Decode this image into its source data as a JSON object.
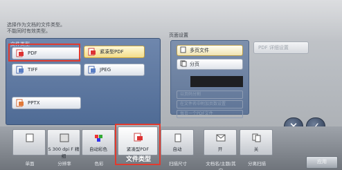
{
  "message": {
    "line1": "选择作为文档的文件类型。",
    "line2": "不能同时有效类型。"
  },
  "file_type_panel": {
    "label": "文件类型",
    "buttons": [
      {
        "label": "PDF",
        "selected": false
      },
      {
        "label": "紧凑型PDF",
        "selected": true
      },
      {
        "label": "TIFF",
        "selected": false
      },
      {
        "label": "JPEG",
        "selected": false
      },
      {
        "label": "PPTX",
        "selected": false
      }
    ]
  },
  "page_settings": {
    "title": "页面设置",
    "multi_page": "多页文件",
    "separate": "分页",
    "option1": "以页码分割",
    "option2": "在文件名中附加页数设置",
    "option3": "每页一个PDF文件"
  },
  "right_button": "PDF 详细设置",
  "actions": {
    "cancel_symbol": "✕",
    "ok_symbol": "✓"
  },
  "tabs": [
    {
      "value": "",
      "caption": "单面",
      "icon": "single-side-icon"
    },
    {
      "value": "S 300 dpi F 精细",
      "caption": "分辨率",
      "icon": "resolution-icon"
    },
    {
      "value": "自动彩色",
      "caption": "色彩",
      "icon": "color-icon"
    },
    {
      "value": "紧凑型PDF",
      "caption": "文件类型",
      "icon": "pdf-icon"
    },
    {
      "value": "自动",
      "caption": "扫描尺寸",
      "icon": "scan-size-icon"
    },
    {
      "value": "开",
      "caption": "文档名/主题/其它",
      "icon": "document-name-icon"
    },
    {
      "value": "关",
      "caption": "分离扫描",
      "icon": "separate-scan-icon"
    }
  ],
  "active_tab_caption": "文件类型",
  "apply_label": "应用",
  "colors": {
    "highlight": "#e23a2e",
    "panel_blue": "#5a739c",
    "selected_yellow": "#f3dd8a"
  }
}
